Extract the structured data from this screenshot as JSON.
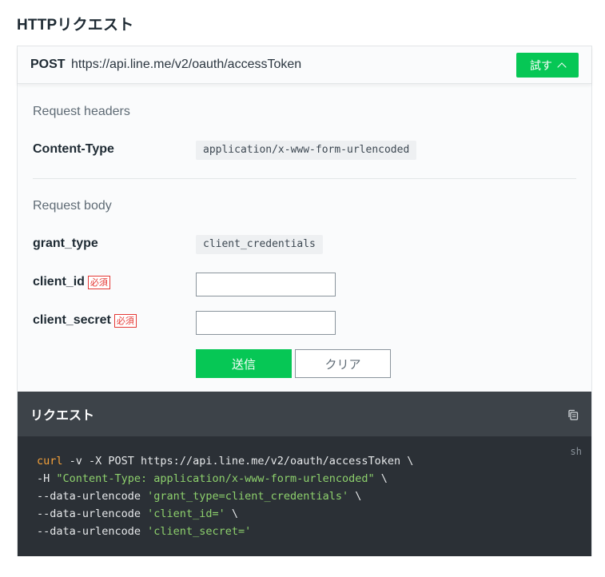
{
  "section": {
    "title": "HTTPリクエスト"
  },
  "endpoint": {
    "method": "POST",
    "url": "https://api.line.me/v2/oauth/accessToken",
    "try_label": "試す"
  },
  "headers": {
    "title": "Request headers",
    "items": [
      {
        "name": "Content-Type",
        "value": "application/x-www-form-urlencoded"
      }
    ]
  },
  "body": {
    "title": "Request body",
    "grant_type": {
      "name": "grant_type",
      "value": "client_credentials"
    },
    "client_id": {
      "name": "client_id",
      "required": "必須",
      "value": ""
    },
    "client_secret": {
      "name": "client_secret",
      "required": "必須",
      "value": ""
    }
  },
  "actions": {
    "send_label": "送信",
    "clear_label": "クリア"
  },
  "request": {
    "title": "リクエスト",
    "lang": "sh",
    "line1": {
      "cmd": "curl",
      "rest": " -v -X POST https://api.line.me/v2/oauth/accessToken \\"
    },
    "line2": {
      "pre": "-H ",
      "str": "\"Content-Type: application/x-www-form-urlencoded\"",
      "post": " \\"
    },
    "line3": {
      "pre": "--data-urlencode ",
      "str": "'grant_type=client_credentials'",
      "post": " \\"
    },
    "line4": {
      "pre": "--data-urlencode ",
      "str": "'client_id='",
      "post": " \\"
    },
    "line5": {
      "pre": "--data-urlencode ",
      "str": "'client_secret='",
      "post": ""
    }
  },
  "colors": {
    "accent": "#06c755",
    "required": "#e53935",
    "code_bg": "#2b3036"
  },
  "icons": {
    "try": "chevron-up-icon",
    "copy": "copy-icon"
  }
}
